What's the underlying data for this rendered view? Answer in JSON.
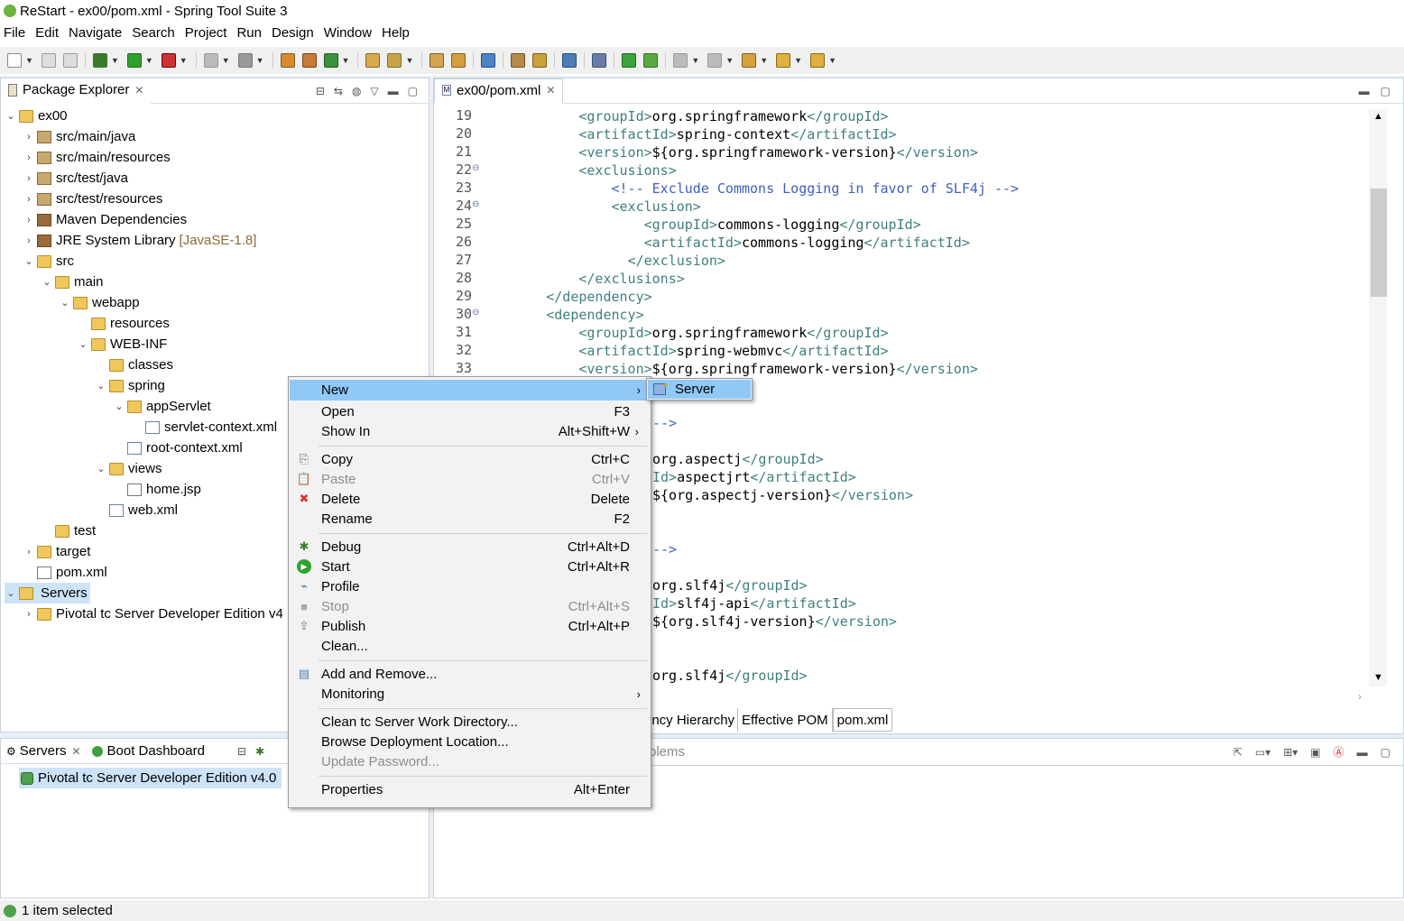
{
  "window": {
    "title": "ReStart - ex00/pom.xml - Spring Tool Suite 3"
  },
  "menubar": [
    "File",
    "Edit",
    "Navigate",
    "Search",
    "Project",
    "Run",
    "Design",
    "Window",
    "Help"
  ],
  "package_explorer": {
    "tab_label": "Package Explorer",
    "tree": [
      {
        "label": "ex00",
        "depth": 0,
        "chev": "v",
        "icon": "project"
      },
      {
        "label": "src/main/java",
        "depth": 1,
        "chev": ">",
        "icon": "pkgfolder"
      },
      {
        "label": "src/main/resources",
        "depth": 1,
        "chev": ">",
        "icon": "pkgfolder"
      },
      {
        "label": "src/test/java",
        "depth": 1,
        "chev": ">",
        "icon": "pkgfolder"
      },
      {
        "label": "src/test/resources",
        "depth": 1,
        "chev": ">",
        "icon": "pkgfolder"
      },
      {
        "label": "Maven Dependencies",
        "depth": 1,
        "chev": ">",
        "icon": "library"
      },
      {
        "label": "JRE System Library",
        "suffix": "[JavaSE-1.8]",
        "depth": 1,
        "chev": ">",
        "icon": "library"
      },
      {
        "label": "src",
        "depth": 1,
        "chev": "v",
        "icon": "folder"
      },
      {
        "label": "main",
        "depth": 2,
        "chev": "v",
        "icon": "folder"
      },
      {
        "label": "webapp",
        "depth": 3,
        "chev": "v",
        "icon": "folder"
      },
      {
        "label": "resources",
        "depth": 4,
        "chev": "",
        "icon": "folder"
      },
      {
        "label": "WEB-INF",
        "depth": 4,
        "chev": "v",
        "icon": "folder"
      },
      {
        "label": "classes",
        "depth": 5,
        "chev": "",
        "icon": "folder"
      },
      {
        "label": "spring",
        "depth": 5,
        "chev": "v",
        "icon": "folder"
      },
      {
        "label": "appServlet",
        "depth": 6,
        "chev": "v",
        "icon": "folder"
      },
      {
        "label": "servlet-context.xml",
        "depth": 7,
        "chev": "",
        "icon": "xml"
      },
      {
        "label": "root-context.xml",
        "depth": 6,
        "chev": "",
        "icon": "xml"
      },
      {
        "label": "views",
        "depth": 5,
        "chev": "v",
        "icon": "folder"
      },
      {
        "label": "home.jsp",
        "depth": 6,
        "chev": "",
        "icon": "file"
      },
      {
        "label": "web.xml",
        "depth": 5,
        "chev": "",
        "icon": "xml"
      },
      {
        "label": "test",
        "depth": 2,
        "chev": "",
        "icon": "folder"
      },
      {
        "label": "target",
        "depth": 1,
        "chev": ">",
        "icon": "folder"
      },
      {
        "label": "pom.xml",
        "depth": 1,
        "chev": "",
        "icon": "file"
      },
      {
        "label": "Servers",
        "depth": 0,
        "chev": "v",
        "icon": "folder",
        "selected": true
      },
      {
        "label": "Pivotal tc Server Developer Edition v4",
        "depth": 1,
        "chev": ">",
        "icon": "folder"
      }
    ]
  },
  "editor": {
    "tab_label": "ex00/pom.xml",
    "lines": [
      {
        "n": "19",
        "fold": false,
        "segs": [
          [
            "t",
            "            "
          ],
          [
            "g",
            "<groupId>"
          ],
          [
            "x",
            "org.springframework"
          ],
          [
            "g",
            "</groupId>"
          ]
        ]
      },
      {
        "n": "20",
        "fold": false,
        "segs": [
          [
            "t",
            "            "
          ],
          [
            "g",
            "<artifactId>"
          ],
          [
            "x",
            "spring-context"
          ],
          [
            "g",
            "</artifactId>"
          ]
        ]
      },
      {
        "n": "21",
        "fold": false,
        "segs": [
          [
            "t",
            "            "
          ],
          [
            "g",
            "<version>"
          ],
          [
            "x",
            "${org.springframework-version}"
          ],
          [
            "g",
            "</version>"
          ]
        ]
      },
      {
        "n": "22",
        "fold": true,
        "segs": [
          [
            "t",
            "            "
          ],
          [
            "g",
            "<exclusions>"
          ]
        ]
      },
      {
        "n": "23",
        "fold": false,
        "segs": [
          [
            "t",
            "                "
          ],
          [
            "c",
            "<!-- Exclude Commons Logging in favor of SLF4j -->"
          ]
        ]
      },
      {
        "n": "24",
        "fold": true,
        "segs": [
          [
            "t",
            "                "
          ],
          [
            "g",
            "<exclusion>"
          ]
        ]
      },
      {
        "n": "25",
        "fold": false,
        "segs": [
          [
            "t",
            "                    "
          ],
          [
            "g",
            "<groupId>"
          ],
          [
            "x",
            "commons-logging"
          ],
          [
            "g",
            "</groupId>"
          ]
        ]
      },
      {
        "n": "26",
        "fold": false,
        "segs": [
          [
            "t",
            "                    "
          ],
          [
            "g",
            "<artifactId>"
          ],
          [
            "x",
            "commons-logging"
          ],
          [
            "g",
            "</artifactId>"
          ]
        ]
      },
      {
        "n": "27",
        "fold": false,
        "segs": [
          [
            "t",
            "                  "
          ],
          [
            "g",
            "</exclusion>"
          ]
        ]
      },
      {
        "n": "28",
        "fold": false,
        "segs": [
          [
            "t",
            "            "
          ],
          [
            "g",
            "</exclusions>"
          ]
        ]
      },
      {
        "n": "29",
        "fold": false,
        "segs": [
          [
            "t",
            "        "
          ],
          [
            "g",
            "</dependency>"
          ]
        ]
      },
      {
        "n": "30",
        "fold": true,
        "segs": [
          [
            "t",
            "        "
          ],
          [
            "g",
            "<dependency>"
          ]
        ]
      },
      {
        "n": "31",
        "fold": false,
        "segs": [
          [
            "t",
            "            "
          ],
          [
            "g",
            "<groupId>"
          ],
          [
            "x",
            "org.springframework"
          ],
          [
            "g",
            "</groupId>"
          ]
        ]
      },
      {
        "n": "32",
        "fold": false,
        "segs": [
          [
            "t",
            "            "
          ],
          [
            "g",
            "<artifactId>"
          ],
          [
            "x",
            "spring-webmvc"
          ],
          [
            "g",
            "</artifactId>"
          ]
        ]
      },
      {
        "n": "33",
        "fold": false,
        "segs": [
          [
            "t",
            "            "
          ],
          [
            "g",
            "<version>"
          ],
          [
            "x",
            "${org.springframework-version}"
          ],
          [
            "g",
            "</version>"
          ]
        ]
      }
    ],
    "visible_fragments": [
      {
        "row": 17,
        "segs": [
          [
            "c",
            "-->"
          ]
        ]
      },
      {
        "row": 19,
        "segs": [
          [
            "x",
            "org.aspectj"
          ],
          [
            "g",
            "</groupId>"
          ]
        ]
      },
      {
        "row": 20,
        "segs": [
          [
            "g",
            "Id>"
          ],
          [
            "x",
            "aspectjrt"
          ],
          [
            "g",
            "</artifactId>"
          ]
        ]
      },
      {
        "row": 21,
        "segs": [
          [
            "x",
            "${org.aspectj-version}"
          ],
          [
            "g",
            "</version>"
          ]
        ]
      },
      {
        "row": 24,
        "segs": [
          [
            "c",
            "-->"
          ]
        ]
      },
      {
        "row": 26,
        "segs": [
          [
            "x",
            "org.slf4j"
          ],
          [
            "g",
            "</groupId>"
          ]
        ]
      },
      {
        "row": 27,
        "segs": [
          [
            "g",
            "Id>"
          ],
          [
            "x",
            "slf4j-api"
          ],
          [
            "g",
            "</artifactId>"
          ]
        ]
      },
      {
        "row": 28,
        "segs": [
          [
            "x",
            "${org.slf4j-version}"
          ],
          [
            "g",
            "</version>"
          ]
        ]
      },
      {
        "row": 31,
        "segs": [
          [
            "x",
            "org.slf4j"
          ],
          [
            "g",
            "</groupId>"
          ]
        ]
      }
    ],
    "bottom_tabs": [
      "ency Hierarchy",
      "Effective POM",
      "pom.xml"
    ]
  },
  "servers_view": {
    "tabs": [
      "Servers",
      "Boot Dashboard"
    ],
    "items": [
      "Pivotal tc Server Developer Edition v4.0"
    ]
  },
  "console_view": {
    "tab_fragment": "blems"
  },
  "context_menu": {
    "items": [
      {
        "label": "New",
        "shortcut": "",
        "submenu": true,
        "highlight": true,
        "icon": ""
      },
      {
        "label": "Open",
        "shortcut": "F3",
        "icon": ""
      },
      {
        "label": "Show In",
        "shortcut": "Alt+Shift+W",
        "submenu": true,
        "icon": ""
      },
      {
        "sep": true
      },
      {
        "label": "Copy",
        "shortcut": "Ctrl+C",
        "icon": "copy"
      },
      {
        "label": "Paste",
        "shortcut": "Ctrl+V",
        "disabled": true,
        "icon": "paste"
      },
      {
        "label": "Delete",
        "shortcut": "Delete",
        "icon": "delete"
      },
      {
        "label": "Rename",
        "shortcut": "F2",
        "icon": ""
      },
      {
        "sep": true
      },
      {
        "label": "Debug",
        "shortcut": "Ctrl+Alt+D",
        "icon": "debug"
      },
      {
        "label": "Start",
        "shortcut": "Ctrl+Alt+R",
        "icon": "start"
      },
      {
        "label": "Profile",
        "shortcut": "",
        "icon": "profile"
      },
      {
        "label": "Stop",
        "shortcut": "Ctrl+Alt+S",
        "disabled": true,
        "icon": "stop"
      },
      {
        "label": "Publish",
        "shortcut": "Ctrl+Alt+P",
        "icon": "publish"
      },
      {
        "label": "Clean...",
        "shortcut": "",
        "icon": ""
      },
      {
        "sep": true
      },
      {
        "label": "Add and Remove...",
        "shortcut": "",
        "icon": "addremove"
      },
      {
        "label": "Monitoring",
        "shortcut": "",
        "submenu": true,
        "icon": ""
      },
      {
        "sep": true
      },
      {
        "label": "Clean tc Server Work Directory...",
        "shortcut": "",
        "icon": ""
      },
      {
        "label": "Browse Deployment Location...",
        "shortcut": "",
        "icon": ""
      },
      {
        "label": "Update Password...",
        "shortcut": "",
        "disabled": true,
        "icon": ""
      },
      {
        "sep": true
      },
      {
        "label": "Properties",
        "shortcut": "Alt+Enter",
        "icon": ""
      }
    ],
    "submenu": {
      "label": "Server"
    }
  },
  "status": {
    "text": "1 item selected"
  },
  "colors": {
    "tag": "#3f7f7f",
    "comment": "#3f5fbf",
    "highlight": "#90c8f6",
    "selection": "#cde3f8"
  }
}
